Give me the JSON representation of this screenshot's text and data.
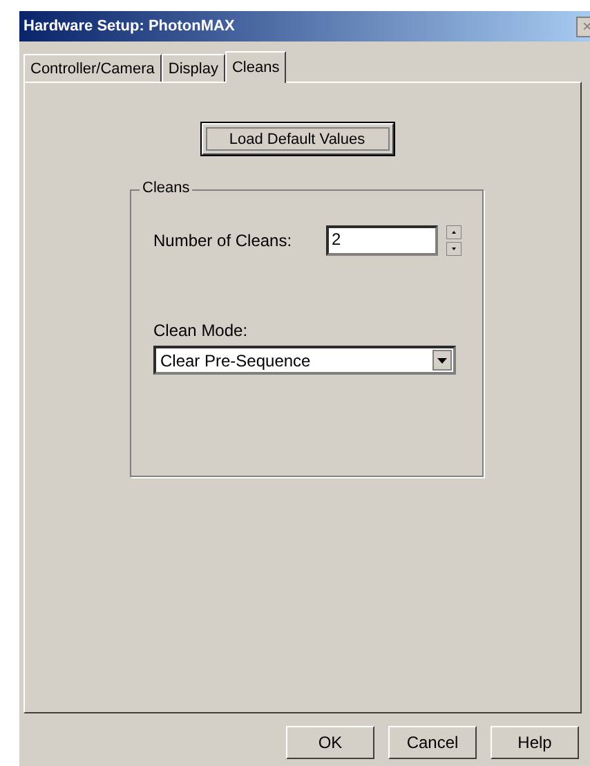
{
  "window": {
    "title": "Hardware Setup: PhotonMAX",
    "close": "×"
  },
  "tabs": [
    {
      "label": "Controller/Camera",
      "selected": false
    },
    {
      "label": "Display",
      "selected": false
    },
    {
      "label": "Cleans",
      "selected": true
    }
  ],
  "load_button": "Load Default Values",
  "group": {
    "title": "Cleans",
    "count_label": "Number of Cleans:",
    "count_value": "2",
    "mode_label": "Clean Mode:",
    "mode_value": "Clear Pre-Sequence"
  },
  "buttons": [
    "OK",
    "Cancel",
    "Help"
  ]
}
